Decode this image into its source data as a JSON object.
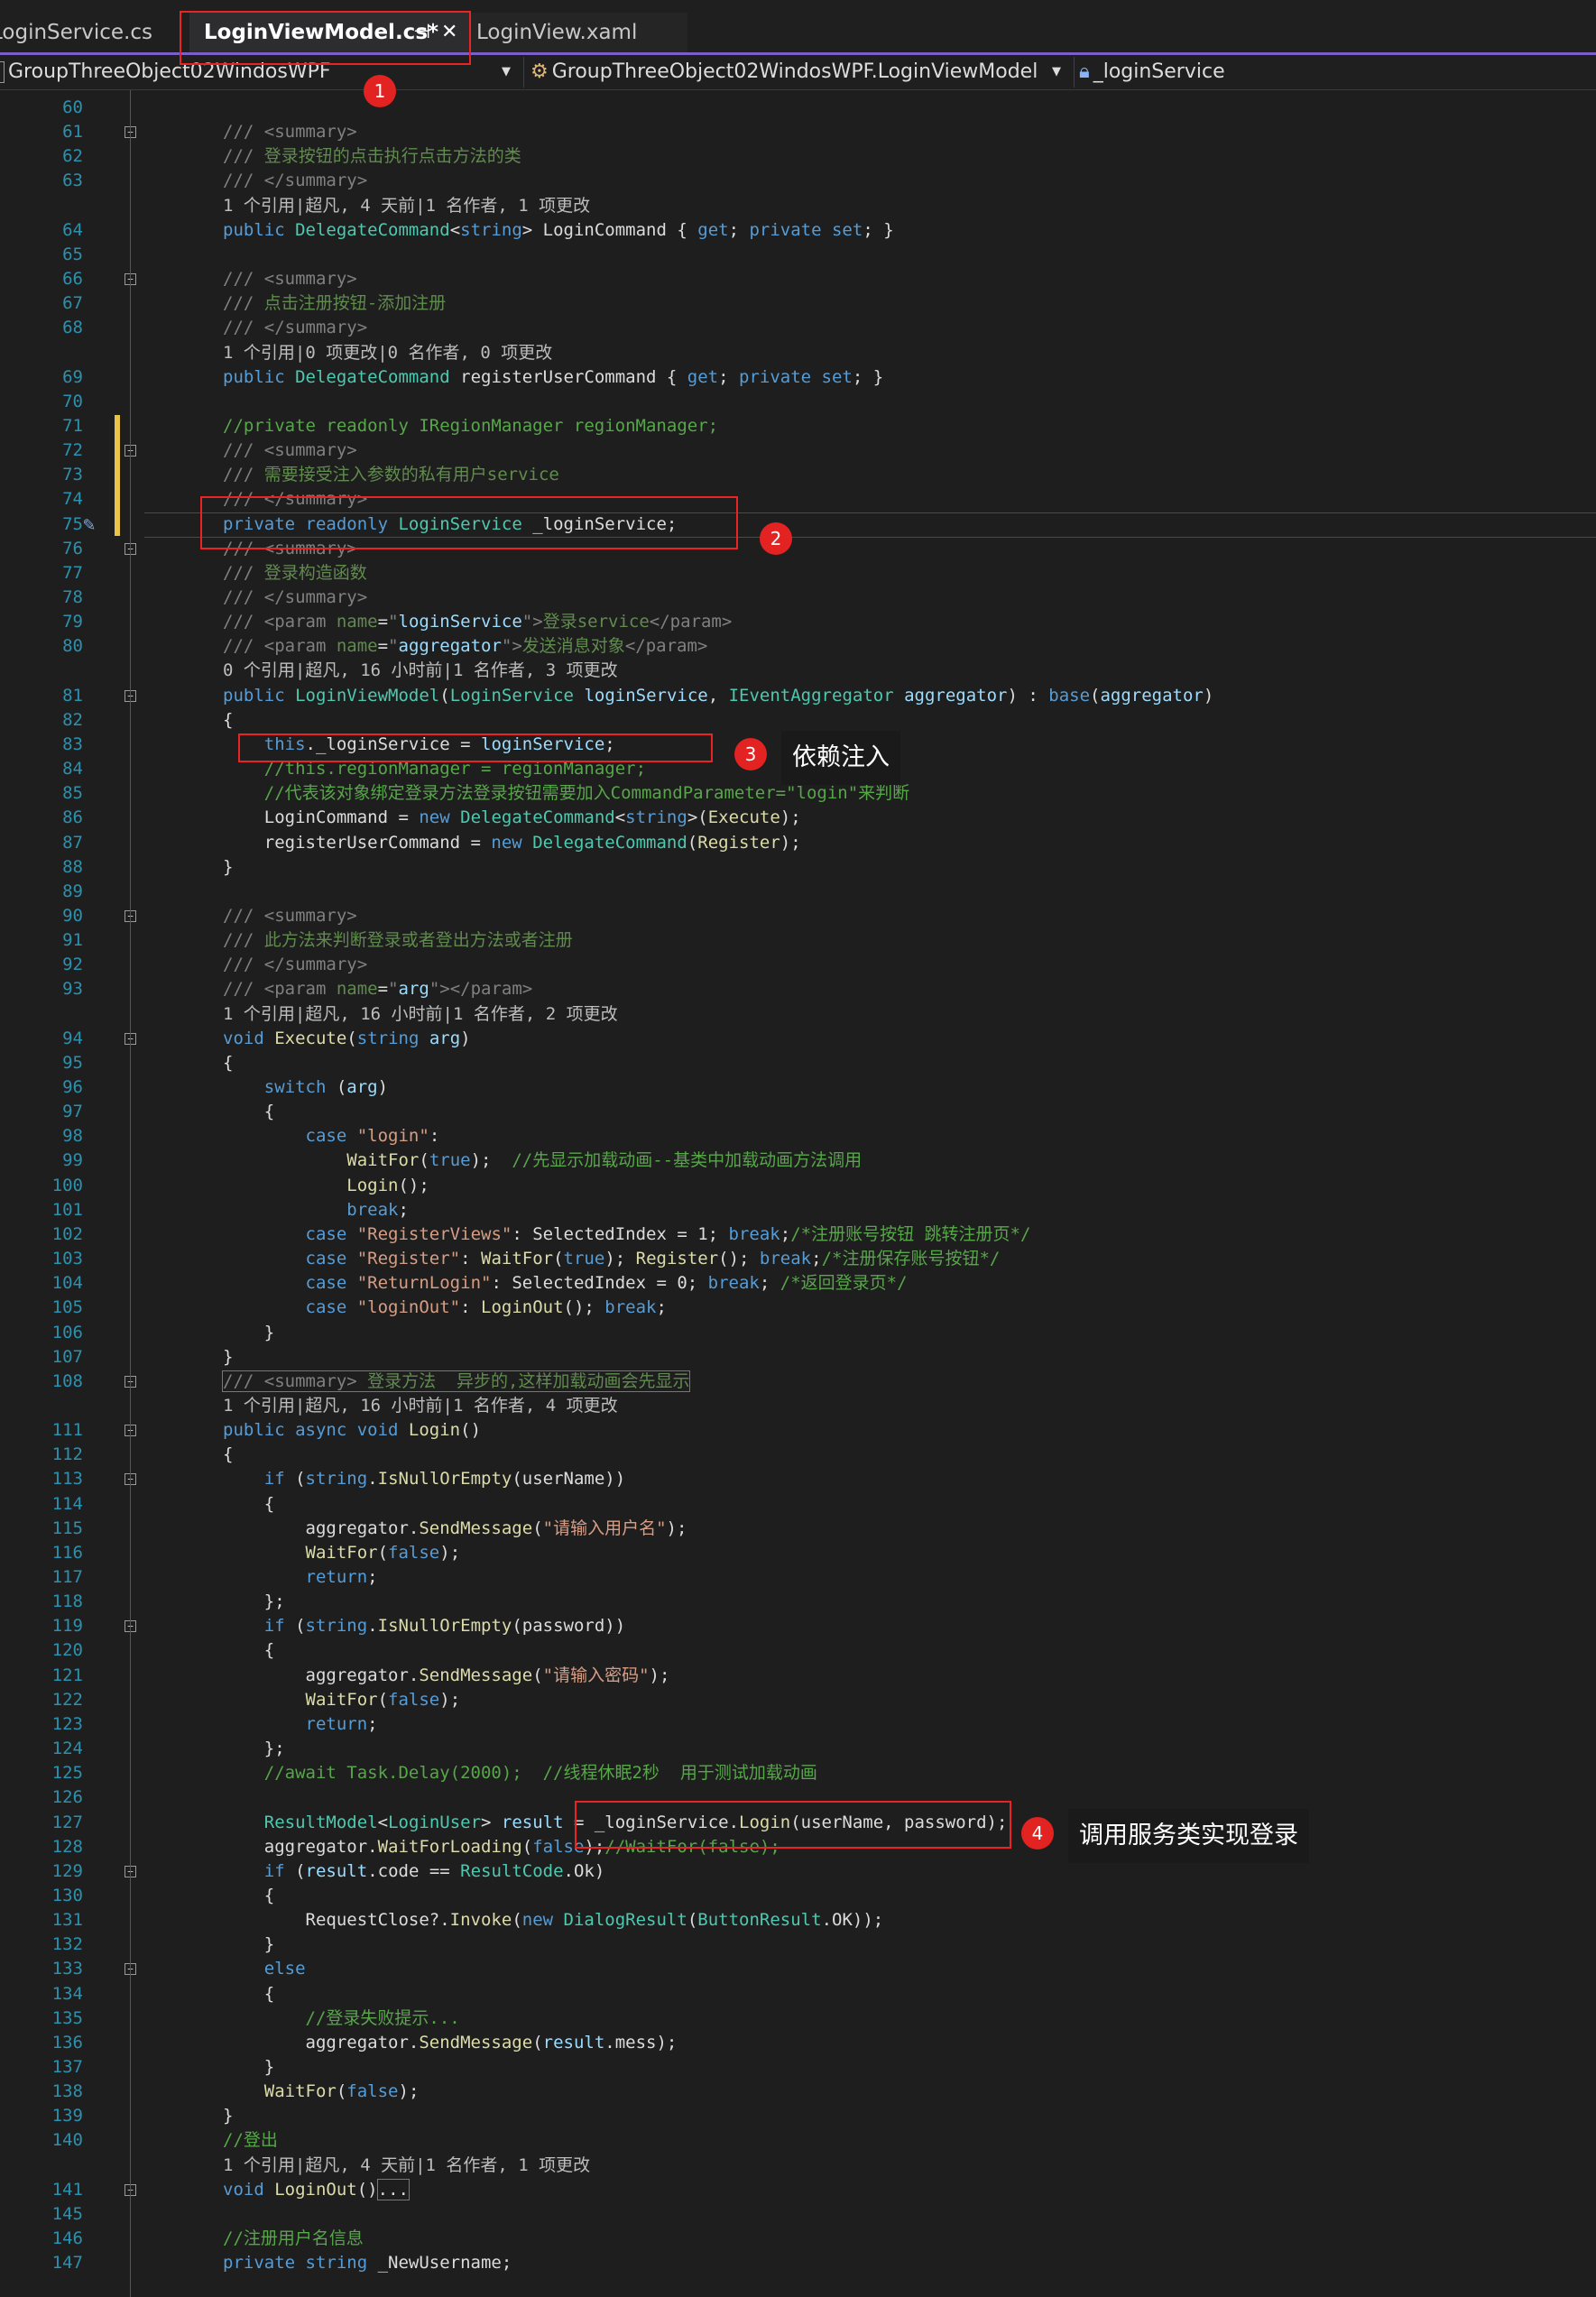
{
  "tabs": [
    {
      "label": "LoginService.cs"
    },
    {
      "label": "LoginViewModel.cs*",
      "active": true,
      "pin_glyph": "⊣",
      "close_glyph": "✕"
    },
    {
      "label": "LoginView.xaml"
    }
  ],
  "navbar": {
    "project": "GroupThreeObject02WindosWPF",
    "class_name": "GroupThreeObject02WindosWPF.LoginViewModel",
    "member": "_loginService"
  },
  "lines": [
    {
      "n": "60",
      "html": ""
    },
    {
      "n": "61",
      "html": "<span class='r'>/// &lt;summary&gt;</span>"
    },
    {
      "n": "62",
      "html": "<span class='r'>///</span><span class='dc'> 登录按钮的点击执行点击方法的类</span>"
    },
    {
      "n": "63",
      "html": "<span class='r'>/// &lt;/summary&gt;</span>"
    },
    {
      "lens": "1 个引用|超凡, 4 天前|1 名作者, 1 项更改"
    },
    {
      "n": "64",
      "html": "<span class='k'>public</span> <span class='t'>DelegateCommand</span>&lt;<span class='k'>string</span>&gt; LoginCommand { <span class='k'>get</span>; <span class='k'>private set</span>; }"
    },
    {
      "n": "65",
      "html": ""
    },
    {
      "n": "66",
      "html": "<span class='r'>/// &lt;summary&gt;</span>"
    },
    {
      "n": "67",
      "html": "<span class='r'>///</span><span class='dc'> 点击注册按钮-添加注册</span>"
    },
    {
      "n": "68",
      "html": "<span class='r'>/// &lt;/summary&gt;</span>"
    },
    {
      "lens": "1 个引用|0 项更改|0 名作者, 0 项更改"
    },
    {
      "n": "69",
      "html": "<span class='k'>public</span> <span class='t'>DelegateCommand</span> registerUserCommand { <span class='k'>get</span>; <span class='k'>private set</span>; }"
    },
    {
      "n": "70",
      "html": ""
    },
    {
      "n": "71",
      "html": "<span class='c'>//private readonly IRegionManager regionManager;</span>"
    },
    {
      "n": "72",
      "html": "<span class='r'>/// &lt;summary&gt;</span>"
    },
    {
      "n": "73",
      "html": "<span class='r'>///</span><span class='dc'> 需要接受注入参数的私有用户service</span>"
    },
    {
      "n": "74",
      "html": "<span class='r'>/// &lt;/summary&gt;</span>"
    },
    {
      "n": "75",
      "html": "<span class='k'>private readonly</span> <span class='t'>LoginService</span> _loginService;"
    },
    {
      "n": "76",
      "html": "<span class='r'>/// &lt;summary&gt;</span>"
    },
    {
      "n": "77",
      "html": "<span class='r'>///</span><span class='dc'> 登录构造函数</span>"
    },
    {
      "n": "78",
      "html": "<span class='r'>/// &lt;/summary&gt;</span>"
    },
    {
      "n": "79",
      "html": "<span class='r'>/// &lt;param</span> <span class='dc'>name</span>=<span class='r'>\"</span><span class='p'>loginService</span><span class='r'>\"&gt;</span><span class='dc'>登录service</span><span class='r'>&lt;/param&gt;</span>"
    },
    {
      "n": "80",
      "html": "<span class='r'>/// &lt;param</span> <span class='dc'>name</span>=<span class='r'>\"</span><span class='p'>aggregator</span><span class='r'>\"&gt;</span><span class='dc'>发送消息对象</span><span class='r'>&lt;/param&gt;</span>"
    },
    {
      "lens": "0 个引用|超凡, 16 小时前|1 名作者, 3 项更改"
    },
    {
      "n": "81",
      "html": "<span class='k'>public</span> <span class='t'>LoginViewModel</span>(<span class='t'>LoginService</span> <span class='p'>loginService</span>, <span class='t'>IEventAggregator</span> <span class='p'>aggregator</span>) : <span class='k'>base</span>(<span class='p'>aggregator</span>)"
    },
    {
      "n": "82",
      "html": "{"
    },
    {
      "n": "83",
      "html": "    <span class='k'>this</span>._loginService = <span class='p'>loginService</span>;"
    },
    {
      "n": "84",
      "html": "    <span class='c'>//this.regionManager = regionManager;</span>"
    },
    {
      "n": "85",
      "html": "    <span class='c'>//代表该对象绑定登录方法登录按钮需要加入CommandParameter=\"login\"来判断</span>"
    },
    {
      "n": "86",
      "html": "    LoginCommand = <span class='k'>new</span> <span class='t'>DelegateCommand</span>&lt;<span class='k'>string</span>&gt;(<span class='m'>Execute</span>);"
    },
    {
      "n": "87",
      "html": "    registerUserCommand = <span class='k'>new</span> <span class='t'>DelegateCommand</span>(<span class='m'>Register</span>);"
    },
    {
      "n": "88",
      "html": "}"
    },
    {
      "n": "89",
      "html": ""
    },
    {
      "n": "90",
      "html": "<span class='r'>/// &lt;summary&gt;</span>"
    },
    {
      "n": "91",
      "html": "<span class='r'>///</span><span class='dc'> 此方法来判断登录或者登出方法或者注册</span>"
    },
    {
      "n": "92",
      "html": "<span class='r'>/// &lt;/summary&gt;</span>"
    },
    {
      "n": "93",
      "html": "<span class='r'>/// &lt;param</span> <span class='dc'>name</span>=<span class='r'>\"</span><span class='p'>arg</span><span class='r'>\"&gt;&lt;/param&gt;</span>"
    },
    {
      "lens": "1 个引用|超凡, 16 小时前|1 名作者, 2 项更改"
    },
    {
      "n": "94",
      "html": "<span class='k'>void</span> <span class='m'>Execute</span>(<span class='k'>string</span> <span class='p'>arg</span>)"
    },
    {
      "n": "95",
      "html": "{"
    },
    {
      "n": "96",
      "html": "    <span class='k'>switch</span> (<span class='p'>arg</span>)"
    },
    {
      "n": "97",
      "html": "    {"
    },
    {
      "n": "98",
      "html": "        <span class='k'>case</span> <span class='s'>\"login\"</span>:"
    },
    {
      "n": "99",
      "html": "            <span class='m'>WaitFor</span>(<span class='k'>true</span>);  <span class='c'>//先显示加载动画--基类中加载动画方法调用</span>"
    },
    {
      "n": "100",
      "html": "            <span class='m'>Login</span>();"
    },
    {
      "n": "101",
      "html": "            <span class='k'>break</span>;"
    },
    {
      "n": "102",
      "html": "        <span class='k'>case</span> <span class='s'>\"RegisterViews\"</span>: SelectedIndex = 1; <span class='k'>break</span>;<span class='c'>/*注册账号按钮 跳转注册页*/</span>"
    },
    {
      "n": "103",
      "html": "        <span class='k'>case</span> <span class='s'>\"Register\"</span>: <span class='m'>WaitFor</span>(<span class='k'>true</span>); <span class='m'>Register</span>(); <span class='k'>break</span>;<span class='c'>/*注册保存账号按钮*/</span>"
    },
    {
      "n": "104",
      "html": "        <span class='k'>case</span> <span class='s'>\"ReturnLogin\"</span>: SelectedIndex = 0; <span class='k'>break</span>; <span class='c'>/*返回登录页*/</span>"
    },
    {
      "n": "105",
      "html": "        <span class='k'>case</span> <span class='s'>\"loginOut\"</span>: <span class='m'>LoginOut</span>(); <span class='k'>break</span>;"
    },
    {
      "n": "106",
      "html": "    }"
    },
    {
      "n": "107",
      "html": "}"
    },
    {
      "n": "108",
      "html": "<span style='outline:1px solid #777;'><span class='r'>/// &lt;summary&gt;</span><span class='dc'> 登录方法  异步的,这样加载动画会先显示</span></span>"
    },
    {
      "lens": "1 个引用|超凡, 16 小时前|1 名作者, 4 项更改"
    },
    {
      "n": "111",
      "html": "<span class='k'>public async void</span> <span class='m'>Login</span>()"
    },
    {
      "n": "112",
      "html": "{"
    },
    {
      "n": "113",
      "html": "    <span class='k'>if</span> (<span class='k'>string</span>.<span class='m'>IsNullOrEmpty</span>(userName))"
    },
    {
      "n": "114",
      "html": "    {"
    },
    {
      "n": "115",
      "html": "        aggregator.<span class='m'>SendMessage</span>(<span class='s'>\"请输入用户名\"</span>);"
    },
    {
      "n": "116",
      "html": "        <span class='m'>WaitFor</span>(<span class='k'>false</span>);"
    },
    {
      "n": "117",
      "html": "        <span class='k'>return</span>;"
    },
    {
      "n": "118",
      "html": "    };"
    },
    {
      "n": "119",
      "html": "    <span class='k'>if</span> (<span class='k'>string</span>.<span class='m'>IsNullOrEmpty</span>(password))"
    },
    {
      "n": "120",
      "html": "    {"
    },
    {
      "n": "121",
      "html": "        aggregator.<span class='m'>SendMessage</span>(<span class='s'>\"请输入密码\"</span>);"
    },
    {
      "n": "122",
      "html": "        <span class='m'>WaitFor</span>(<span class='k'>false</span>);"
    },
    {
      "n": "123",
      "html": "        <span class='k'>return</span>;"
    },
    {
      "n": "124",
      "html": "    };"
    },
    {
      "n": "125",
      "html": "    <span class='c'>//await Task.Delay(2000);  //线程休眠2秒  用于测试加载动画</span>"
    },
    {
      "n": "126",
      "html": ""
    },
    {
      "n": "127",
      "html": "    <span class='t'>ResultModel</span>&lt;<span class='t'>LoginUser</span>&gt; <span class='p'>result</span> = _loginService.<span class='m'>Login</span>(userName, password);"
    },
    {
      "n": "128",
      "html": "    aggregator.<span class='m'>WaitForLoading</span>(<span class='k'>false</span>);<span class='c'>//WaitFor(false);</span>"
    },
    {
      "n": "129",
      "html": "    <span class='k'>if</span> (<span class='p'>result</span>.code == <span class='t'>ResultCode</span>.Ok)"
    },
    {
      "n": "130",
      "html": "    {"
    },
    {
      "n": "131",
      "html": "        RequestClose?.<span class='m'>Invoke</span>(<span class='k'>new</span> <span class='t'>DialogResult</span>(<span class='t'>ButtonResult</span>.OK));"
    },
    {
      "n": "132",
      "html": "    }"
    },
    {
      "n": "133",
      "html": "    <span class='k'>else</span>"
    },
    {
      "n": "134",
      "html": "    {"
    },
    {
      "n": "135",
      "html": "        <span class='c'>//登录失败提示...</span>"
    },
    {
      "n": "136",
      "html": "        aggregator.<span class='m'>SendMessage</span>(<span class='p'>result</span>.mess);"
    },
    {
      "n": "137",
      "html": "    }"
    },
    {
      "n": "138",
      "html": "    <span class='m'>WaitFor</span>(<span class='k'>false</span>);"
    },
    {
      "n": "139",
      "html": "}"
    },
    {
      "n": "140",
      "html": "<span class='c'>//登出</span>"
    },
    {
      "lens": "1 个引用|超凡, 4 天前|1 名作者, 1 项更改"
    },
    {
      "n": "141",
      "html": "<span class='k'>void</span> <span class='m'>LoginOut</span>()<span style='outline:1px solid #777;'>...</span>"
    },
    {
      "n": "145",
      "html": ""
    },
    {
      "n": "146",
      "html": "<span class='c'>//注册用户名信息</span>"
    },
    {
      "n": "147",
      "html": "<span class='k'>private string</span> _NewUsername;"
    }
  ],
  "annotations": [
    {
      "label": "1"
    },
    {
      "label": "2"
    },
    {
      "label": "3",
      "note": "依赖注入"
    },
    {
      "label": "4",
      "note": "调用服务类实现登录"
    }
  ],
  "colors": {
    "annotation_red": "#e82424",
    "editor_bg": "#1e1e1e",
    "accent": "#7a5fc9"
  }
}
